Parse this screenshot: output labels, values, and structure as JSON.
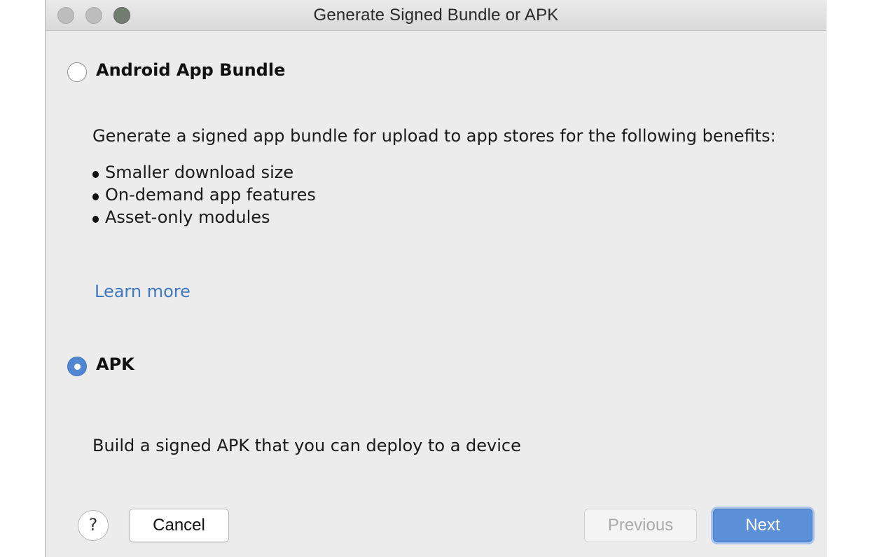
{
  "window": {
    "title": "Generate Signed Bundle or APK"
  },
  "options": {
    "bundle": {
      "label": "Android App Bundle",
      "selected": false,
      "description": "Generate a signed app bundle for upload to app stores for the following benefits:",
      "benefits": [
        "Smaller download size",
        "On-demand app features",
        "Asset-only modules"
      ],
      "learn_more": "Learn more"
    },
    "apk": {
      "label": "APK",
      "selected": true,
      "description": "Build a signed APK that you can deploy to a device"
    }
  },
  "footer": {
    "help_label": "?",
    "cancel_label": "Cancel",
    "previous_label": "Previous",
    "next_label": "Next"
  },
  "colors": {
    "accent": "#5b8fd8",
    "link": "#3f78c0",
    "disabled_text": "#aaaaaa"
  }
}
